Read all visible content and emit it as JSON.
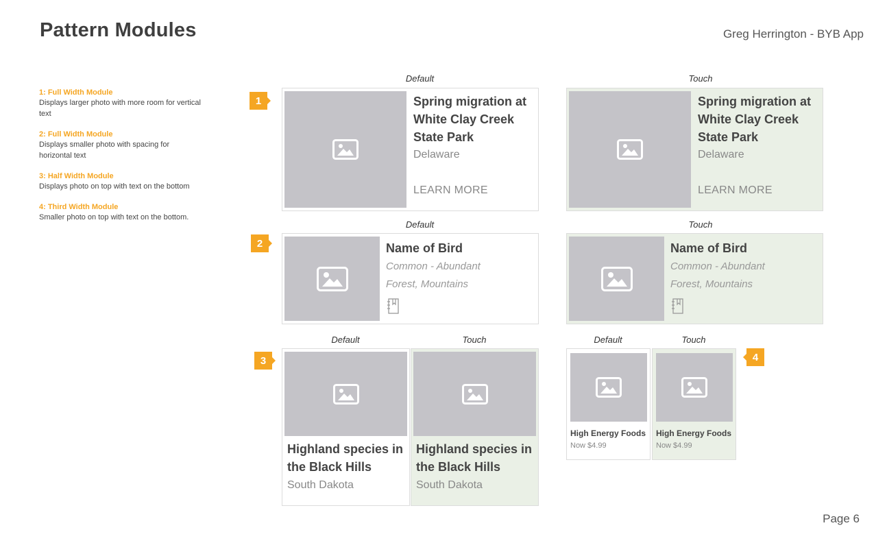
{
  "header": {
    "title": "Pattern Modules",
    "author": "Greg Herrington - BYB App"
  },
  "footer": {
    "page": "Page 6"
  },
  "legend": [
    {
      "title": "1: Full Width Module",
      "desc": "Displays larger photo with more room for vertical text"
    },
    {
      "title": "2: Full Width Module",
      "desc": "Displays smaller photo with spacing for horizontal text"
    },
    {
      "title": "3: Half Width Module",
      "desc": "Displays photo on top with text on the bottom"
    },
    {
      "title": "4: Third Width Module",
      "desc": "Smaller photo on top with text on the bottom."
    }
  ],
  "states": {
    "default": "Default",
    "touch": "Touch"
  },
  "markers": [
    "1",
    "2",
    "3",
    "4"
  ],
  "module1": {
    "title": "Spring migration at White Clay Creek State Park",
    "location": "Delaware",
    "cta": "LEARN MORE"
  },
  "module2": {
    "name": "Name of Bird",
    "status": "Common - Abundant",
    "habitat": "Forest, Mountains"
  },
  "module3": {
    "title": "Highland species in the Black Hills",
    "location": "South Dakota"
  },
  "module4": {
    "title": "High Energy Foods",
    "price": "Now $4.99"
  },
  "colors": {
    "accent": "#f5a623",
    "touch_bg": "#eaf0e6",
    "photo_placeholder": "#c4c3c8"
  },
  "icons": {
    "photo": "image-placeholder-icon",
    "notebook": "field-notebook-icon"
  }
}
